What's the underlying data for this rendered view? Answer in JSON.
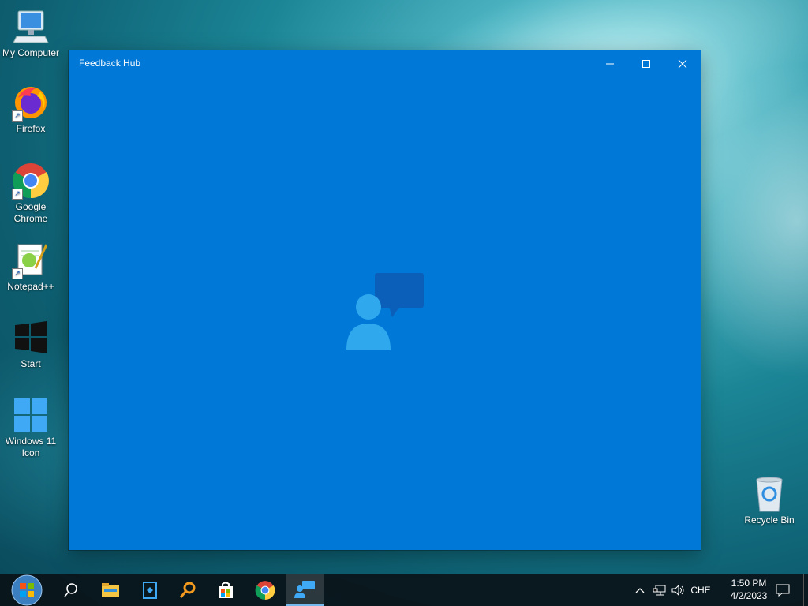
{
  "desktop": {
    "icons": [
      {
        "label": "My Computer"
      },
      {
        "label": "Firefox"
      },
      {
        "label": "Google Chrome"
      },
      {
        "label": "Notepad++"
      },
      {
        "label": "Start"
      },
      {
        "label": "Windows 11 Icon"
      },
      {
        "label": "Recycle Bin"
      }
    ]
  },
  "window": {
    "title": "Feedback Hub",
    "accent": "#0078d7",
    "controls": {
      "minimize": "minimize-icon",
      "maximize": "maximize-icon",
      "close": "close-icon"
    },
    "splash_icon": "feedback-hub-logo-icon"
  },
  "taskbar": {
    "items": [
      "start-orb-icon",
      "search-icon",
      "file-explorer-icon",
      "feedback-app-icon",
      "search-tool-icon",
      "store-icon",
      "chrome-icon",
      "feedback-hub-icon"
    ],
    "active": "feedback-hub-icon",
    "language": "CHE",
    "time": "1:50 PM",
    "date": "4/2/2023"
  }
}
